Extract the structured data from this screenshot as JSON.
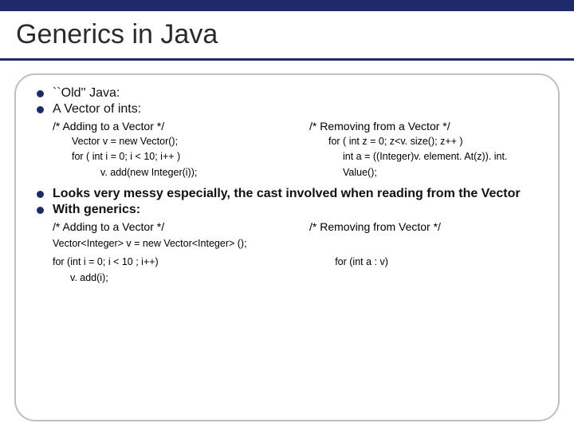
{
  "title": "Generics in Java",
  "bullets1": {
    "item1": "``Old'' Java:",
    "item2": "A Vector of ints:"
  },
  "section1": {
    "left": {
      "head": "/* Adding to a Vector */",
      "l1": "Vector v = new Vector();",
      "l2": "for ( int i  = 0; i < 10; i++ )",
      "l3": "v. add(new Integer(i));"
    },
    "right": {
      "head": "/* Removing from a Vector */",
      "l1": "for ( int z = 0; z<v. size(); z++ )",
      "l2": "int a = ((Integer)v. element. At(z)). int. Value();"
    }
  },
  "bullets2": {
    "item1": "Looks very messy especially, the cast involved when reading from the Vector",
    "item2": "With generics:"
  },
  "section2": {
    "left_head": "/* Adding to a Vector */",
    "right_head": "/* Removing from Vector */",
    "decl": "Vector<Integer> v = new Vector<Integer> ();",
    "left_code1": "for (int i = 0; i < 10 ; i++)",
    "left_code2": "v. add(i);",
    "right_code1": "for (int a : v)"
  }
}
